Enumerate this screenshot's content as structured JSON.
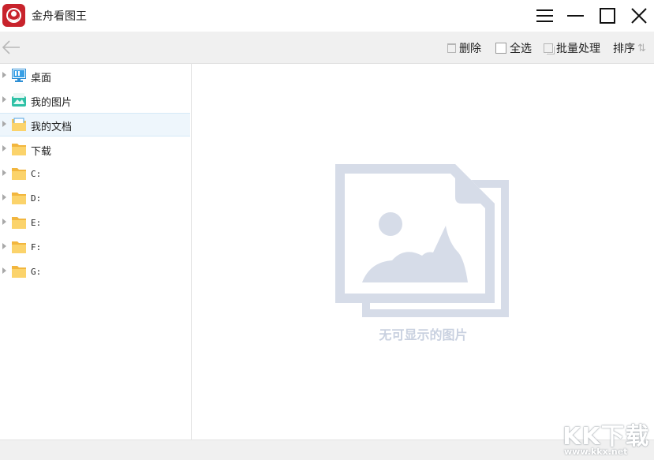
{
  "app": {
    "title": "金舟看图王",
    "brand_color": "#c8232c"
  },
  "window_controls": {
    "menu_icon": "hamburger-menu-icon",
    "minimize_icon": "minimize-icon",
    "maximize_icon": "maximize-icon",
    "close_icon": "close-icon"
  },
  "toolbar": {
    "back_icon": "arrow-left-icon",
    "delete_label": "删除",
    "select_all_label": "全选",
    "batch_label": "批量处理",
    "sort_label": "排序",
    "sort_icon": "⇅"
  },
  "sidebar": {
    "items": [
      {
        "label": "桌面",
        "icon": "desktop-icon",
        "selected": false
      },
      {
        "label": "我的图片",
        "icon": "pictures-icon",
        "selected": false
      },
      {
        "label": "我的文档",
        "icon": "documents-icon",
        "selected": true
      },
      {
        "label": "下载",
        "icon": "folder-icon",
        "selected": false
      },
      {
        "label": "C:",
        "icon": "folder-icon",
        "selected": false
      },
      {
        "label": "D:",
        "icon": "folder-icon",
        "selected": false
      },
      {
        "label": "E:",
        "icon": "folder-icon",
        "selected": false
      },
      {
        "label": "F:",
        "icon": "folder-icon",
        "selected": false
      },
      {
        "label": "G:",
        "icon": "folder-icon",
        "selected": false
      }
    ]
  },
  "main": {
    "empty_message": "无可显示的图片",
    "empty_icon": "image-placeholder-icon",
    "placeholder_color": "#d6dce8"
  },
  "watermark": {
    "logo_text": "KK下载",
    "url": "www.kkx.net"
  }
}
